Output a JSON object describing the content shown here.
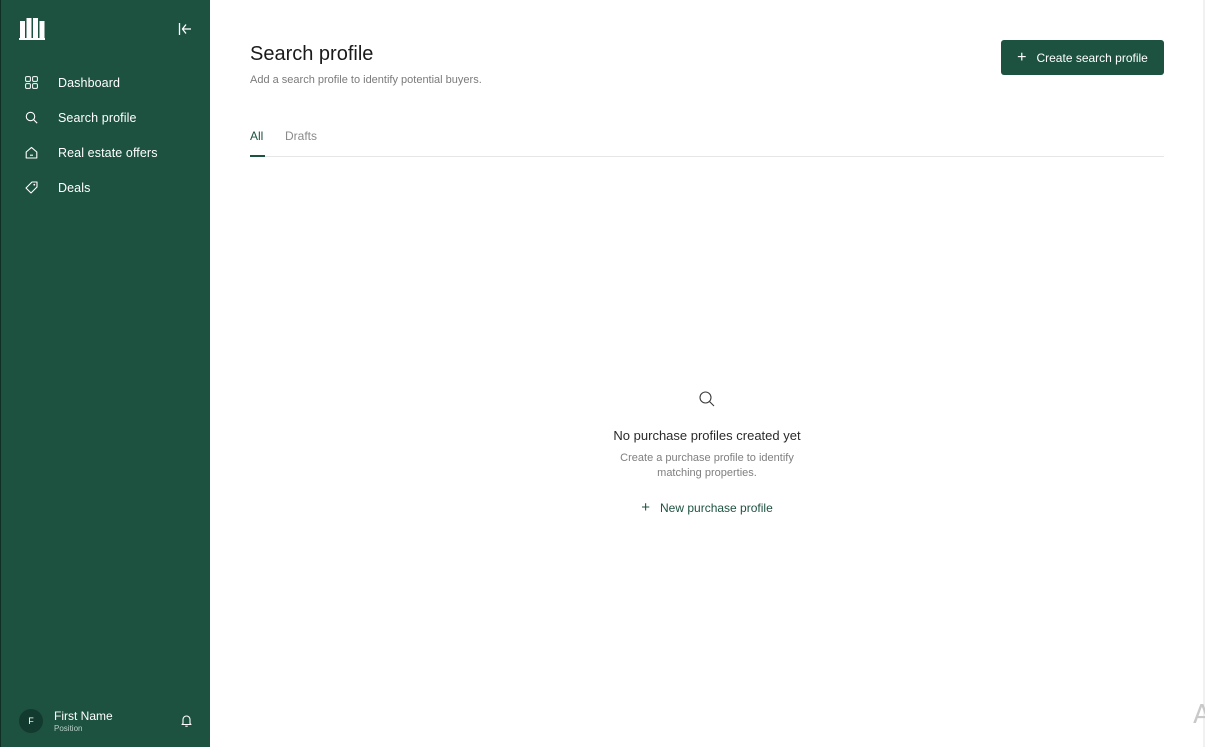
{
  "sidebar": {
    "logo_icon": "building-columns-icon",
    "collapse_icon": "collapse-left-icon",
    "items": [
      {
        "label": "Dashboard",
        "icon": "grid-icon"
      },
      {
        "label": "Search profile",
        "icon": "search-icon"
      },
      {
        "label": "Real estate offers",
        "icon": "home-icon"
      },
      {
        "label": "Deals",
        "icon": "tag-icon"
      }
    ],
    "user": {
      "initial": "F",
      "name": "First Name",
      "position": "Position"
    },
    "bell_icon": "bell-icon"
  },
  "header": {
    "title": "Search profile",
    "subtitle": "Add a search profile to identify potential buyers.",
    "create_button": "Create search profile",
    "create_plus": "+"
  },
  "tabs": [
    {
      "label": "All",
      "active": true
    },
    {
      "label": "Drafts",
      "active": false
    }
  ],
  "empty_state": {
    "icon": "search-icon",
    "title": "No purchase profiles created yet",
    "description_line1": "Create a purchase profile to identify",
    "description_line2": "matching properties.",
    "action_label": "New purchase profile",
    "action_plus": "+"
  },
  "corner_glyph": "A",
  "colors": {
    "sidebar_bg": "#1d5241",
    "accent": "#1d5241",
    "text_muted": "#7b7b7b"
  }
}
